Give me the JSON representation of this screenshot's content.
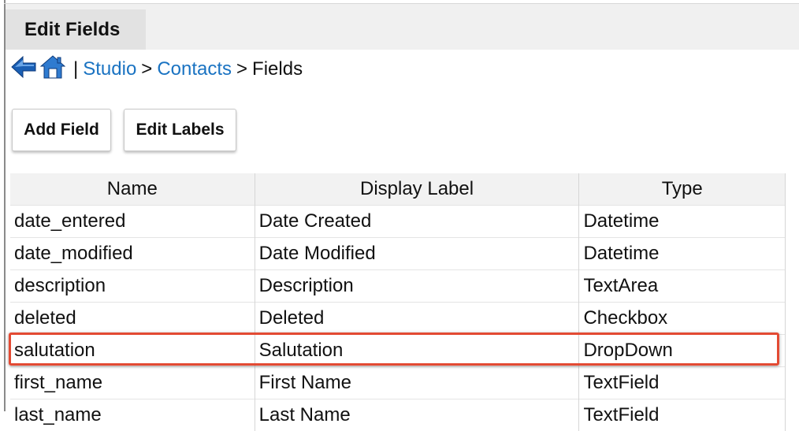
{
  "header": {
    "tab_label": "Edit Fields"
  },
  "breadcrumb": {
    "back_icon": "back-arrow-icon",
    "home_icon": "home-icon",
    "separator_pipe": "|",
    "items": [
      "Studio",
      "Contacts",
      "Fields"
    ],
    "separator": ">"
  },
  "toolbar": {
    "add_field_label": "Add Field",
    "edit_labels_label": "Edit Labels"
  },
  "table": {
    "columns": [
      "Name",
      "Display Label",
      "Type"
    ],
    "rows": [
      [
        "date_entered",
        "Date Created",
        "Datetime"
      ],
      [
        "date_modified",
        "Date Modified",
        "Datetime"
      ],
      [
        "description",
        "Description",
        "TextArea"
      ],
      [
        "deleted",
        "Deleted",
        "Checkbox"
      ],
      [
        "salutation",
        "Salutation",
        "DropDown"
      ],
      [
        "first_name",
        "First Name",
        "TextField"
      ],
      [
        "last_name",
        "Last Name",
        "TextField"
      ]
    ],
    "highlighted_row": "salutation"
  },
  "colors": {
    "link": "#1a73c2",
    "highlight": "#e34a33",
    "header_bg": "#f0f0f0"
  }
}
